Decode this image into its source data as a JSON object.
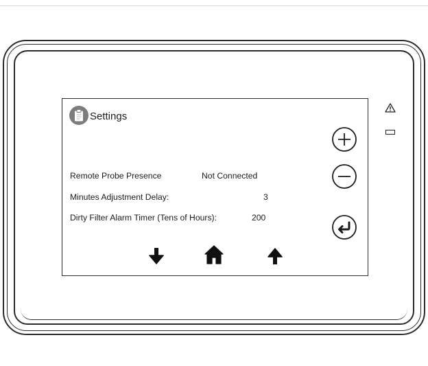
{
  "screen": {
    "title": "Settings",
    "title_icon": "clipboard-icon",
    "rows": [
      {
        "label": "Remote Probe Presence",
        "value": "Not Connected"
      },
      {
        "label": "Minutes Adjustment Delay:",
        "value": "3"
      },
      {
        "label": "Dirty Filter Alarm Timer (Tens of Hours):",
        "value": "200"
      }
    ]
  },
  "side_buttons": [
    {
      "name": "increase",
      "icon": "plus-circle-icon"
    },
    {
      "name": "decrease",
      "icon": "minus-circle-icon"
    },
    {
      "name": "enter",
      "icon": "enter-return-icon"
    }
  ],
  "nav_buttons": [
    {
      "name": "down",
      "icon": "arrow-down-icon"
    },
    {
      "name": "home",
      "icon": "home-icon"
    },
    {
      "name": "up",
      "icon": "arrow-up-icon"
    }
  ],
  "indicators": [
    {
      "name": "alarm",
      "icon": "warning-triangle-icon"
    },
    {
      "name": "status-led",
      "icon": "led-indicator"
    }
  ],
  "colors": {
    "icon_badge": "#7d7d7d",
    "outline": "#2a2a2a",
    "background": "#ffffff"
  }
}
